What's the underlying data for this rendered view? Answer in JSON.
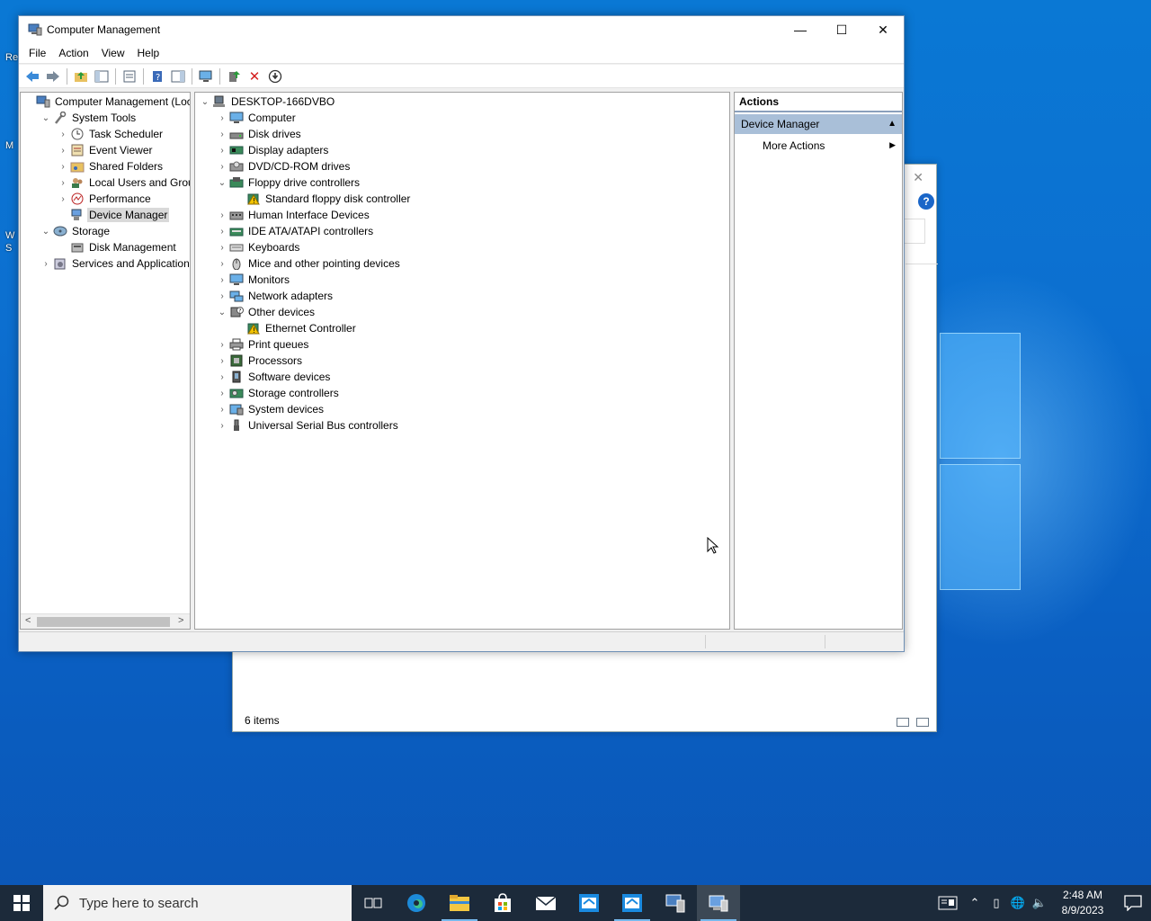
{
  "desktop": {
    "labels": [
      "Re",
      "M",
      "W",
      "S"
    ]
  },
  "background_window": {
    "status_text": "6 items"
  },
  "window": {
    "title": "Computer Management",
    "controls": {
      "minimize": "—",
      "maximize": "☐",
      "close": "✕"
    }
  },
  "menu": [
    "File",
    "Action",
    "View",
    "Help"
  ],
  "left_tree": [
    {
      "label": "Computer Management (Local",
      "depth": 0,
      "expander": "",
      "icon": "computer-management-icon"
    },
    {
      "label": "System Tools",
      "depth": 1,
      "expander": "v",
      "icon": "tools-icon"
    },
    {
      "label": "Task Scheduler",
      "depth": 2,
      "expander": ">",
      "icon": "clock-icon"
    },
    {
      "label": "Event Viewer",
      "depth": 2,
      "expander": ">",
      "icon": "event-viewer-icon"
    },
    {
      "label": "Shared Folders",
      "depth": 2,
      "expander": ">",
      "icon": "shared-folder-icon"
    },
    {
      "label": "Local Users and Groups",
      "depth": 2,
      "expander": ">",
      "icon": "users-icon"
    },
    {
      "label": "Performance",
      "depth": 2,
      "expander": ">",
      "icon": "performance-icon"
    },
    {
      "label": "Device Manager",
      "depth": 2,
      "expander": "",
      "icon": "device-manager-icon",
      "selected": true
    },
    {
      "label": "Storage",
      "depth": 1,
      "expander": "v",
      "icon": "storage-icon"
    },
    {
      "label": "Disk Management",
      "depth": 2,
      "expander": "",
      "icon": "disk-management-icon"
    },
    {
      "label": "Services and Applications",
      "depth": 1,
      "expander": ">",
      "icon": "services-icon"
    }
  ],
  "device_tree": [
    {
      "label": "DESKTOP-166DVBO",
      "depth": 0,
      "expander": "v",
      "icon": "computer-icon"
    },
    {
      "label": "Computer",
      "depth": 1,
      "expander": ">",
      "icon": "monitor-icon"
    },
    {
      "label": "Disk drives",
      "depth": 1,
      "expander": ">",
      "icon": "disk-drive-icon"
    },
    {
      "label": "Display adapters",
      "depth": 1,
      "expander": ">",
      "icon": "display-adapter-icon"
    },
    {
      "label": "DVD/CD-ROM drives",
      "depth": 1,
      "expander": ">",
      "icon": "dvd-icon"
    },
    {
      "label": "Floppy drive controllers",
      "depth": 1,
      "expander": "v",
      "icon": "floppy-controller-icon"
    },
    {
      "label": "Standard floppy disk controller",
      "depth": 2,
      "expander": "",
      "icon": "warning-device-icon"
    },
    {
      "label": "Human Interface Devices",
      "depth": 1,
      "expander": ">",
      "icon": "hid-icon"
    },
    {
      "label": "IDE ATA/ATAPI controllers",
      "depth": 1,
      "expander": ">",
      "icon": "ide-icon"
    },
    {
      "label": "Keyboards",
      "depth": 1,
      "expander": ">",
      "icon": "keyboard-icon"
    },
    {
      "label": "Mice and other pointing devices",
      "depth": 1,
      "expander": ">",
      "icon": "mouse-icon"
    },
    {
      "label": "Monitors",
      "depth": 1,
      "expander": ">",
      "icon": "monitor-icon"
    },
    {
      "label": "Network adapters",
      "depth": 1,
      "expander": ">",
      "icon": "network-adapter-icon"
    },
    {
      "label": "Other devices",
      "depth": 1,
      "expander": "v",
      "icon": "other-devices-icon"
    },
    {
      "label": "Ethernet Controller",
      "depth": 2,
      "expander": "",
      "icon": "warning-device-icon"
    },
    {
      "label": "Print queues",
      "depth": 1,
      "expander": ">",
      "icon": "printer-icon"
    },
    {
      "label": "Processors",
      "depth": 1,
      "expander": ">",
      "icon": "processor-icon"
    },
    {
      "label": "Software devices",
      "depth": 1,
      "expander": ">",
      "icon": "software-device-icon"
    },
    {
      "label": "Storage controllers",
      "depth": 1,
      "expander": ">",
      "icon": "storage-controller-icon"
    },
    {
      "label": "System devices",
      "depth": 1,
      "expander": ">",
      "icon": "system-device-icon"
    },
    {
      "label": "Universal Serial Bus controllers",
      "depth": 1,
      "expander": ">",
      "icon": "usb-icon"
    }
  ],
  "actions": {
    "header": "Actions",
    "section": "Device Manager",
    "item": "More Actions"
  },
  "taskbar": {
    "search_placeholder": "Type here to search",
    "time": "2:48 AM",
    "date": "8/9/2023"
  },
  "colors": {
    "accent": "#0a78d4",
    "selection": "#d9d9d9",
    "actions_section": "#a9bfd8",
    "taskbar": "#1c2a3a",
    "warning": "#f2c200",
    "delete_red": "#d41f1f"
  }
}
